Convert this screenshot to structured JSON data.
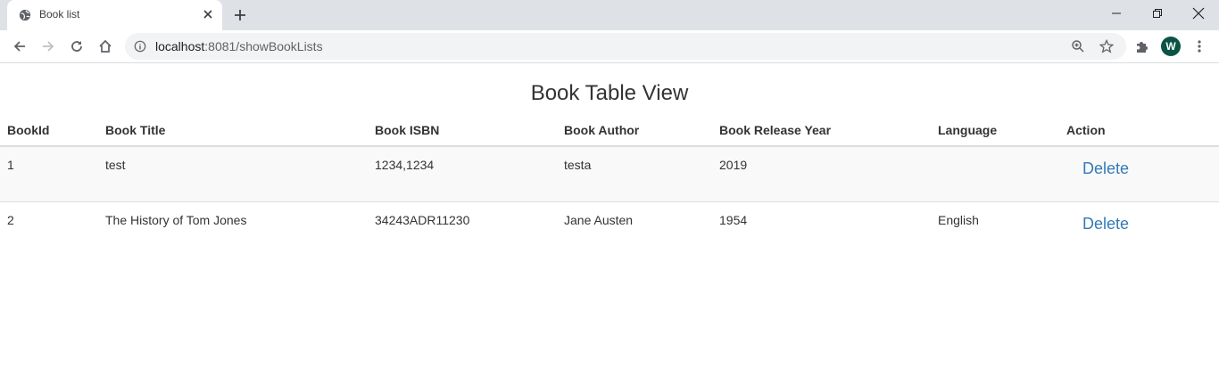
{
  "browser": {
    "tab_title": "Book list",
    "url_host": "localhost",
    "url_path": ":8081/showBookLists",
    "avatar_letter": "W"
  },
  "page": {
    "title": "Book Table View",
    "columns": [
      "BookId",
      "Book Title",
      "Book ISBN",
      "Book Author",
      "Book Release Year",
      "Language",
      "Action"
    ],
    "rows": [
      {
        "id": "1",
        "title": "test",
        "isbn": "1234,1234",
        "author": "testa",
        "year": "2019",
        "language": "",
        "action": "Delete"
      },
      {
        "id": "2",
        "title": "The History of Tom Jones",
        "isbn": "34243ADR11230",
        "author": "Jane Austen",
        "year": "1954",
        "language": "English",
        "action": "Delete"
      }
    ]
  },
  "colors": {
    "link": "#337ab7",
    "stripe": "#f9f9f9"
  }
}
